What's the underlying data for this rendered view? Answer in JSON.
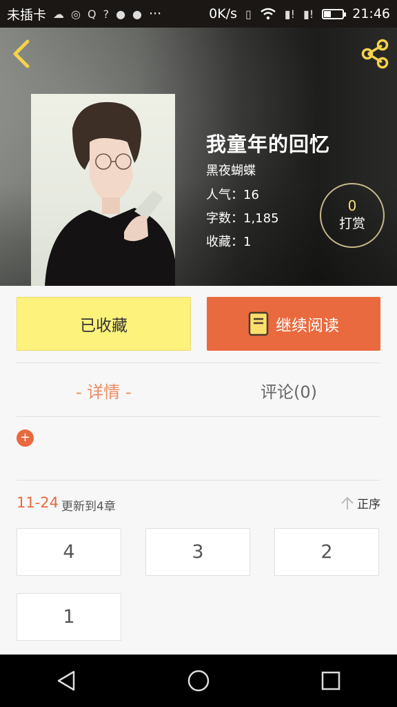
{
  "status_bar": {
    "carrier": "未插卡",
    "speed": "0K/s",
    "time": "21:46",
    "more": "···"
  },
  "book": {
    "title": "我童年的回忆",
    "author": "黑夜蝴蝶",
    "popularity": "人气：16",
    "word_count": "字数：1,185",
    "favorites": "收藏：1"
  },
  "tip": {
    "count": "0",
    "label": "打赏"
  },
  "actions": {
    "favorited_label": "已收藏",
    "continue_label": "继续阅读"
  },
  "tabs": {
    "details": "- 详情 -",
    "comments": "评论(0)"
  },
  "expand": {
    "symbol": "+"
  },
  "updates": {
    "range": "11-24",
    "text": "更新到4章",
    "sort_label": "正序"
  },
  "chapters": [
    "4",
    "3",
    "2",
    "1"
  ],
  "colors": {
    "accent": "#e86a3e",
    "favorite_button": "#fcf27c",
    "tip_count": "#f6e46a"
  },
  "icons": [
    "back-arrow-icon",
    "share-icon",
    "book-icon",
    "sort-up-arrow-icon",
    "nav-back-icon",
    "nav-home-icon",
    "nav-recents-icon"
  ]
}
